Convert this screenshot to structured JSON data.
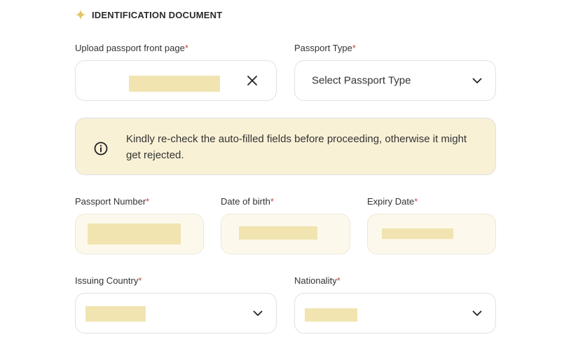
{
  "section": {
    "title": "IDENTIFICATION DOCUMENT",
    "icon": "sparkle-icon"
  },
  "fields": {
    "upload_passport": {
      "label": "Upload passport front page",
      "required_mark": "*",
      "action_icon": "close-icon"
    },
    "passport_type": {
      "label": "Passport Type",
      "required_mark": "*",
      "placeholder": "Select Passport Type",
      "icon": "chevron-down-icon"
    },
    "passport_number": {
      "label": "Passport Number",
      "required_mark": "*"
    },
    "date_of_birth": {
      "label": "Date of birth",
      "required_mark": "*"
    },
    "expiry_date": {
      "label": "Expiry Date",
      "required_mark": "*"
    },
    "issuing_country": {
      "label": "Issuing Country",
      "required_mark": "*",
      "icon": "chevron-down-icon"
    },
    "nationality": {
      "label": "Nationality",
      "required_mark": "*",
      "icon": "chevron-down-icon"
    }
  },
  "notice": {
    "icon": "info-icon",
    "text": "Kindly re-check the auto-filled fields before proceeding, otherwise it might get rejected."
  },
  "colors": {
    "required": "#c44a3e",
    "notice_bg": "#f9f1d6",
    "filled_bg": "#fcf9ec",
    "redaction": "#f1e4b0",
    "sparkle": "#e2c66a"
  }
}
